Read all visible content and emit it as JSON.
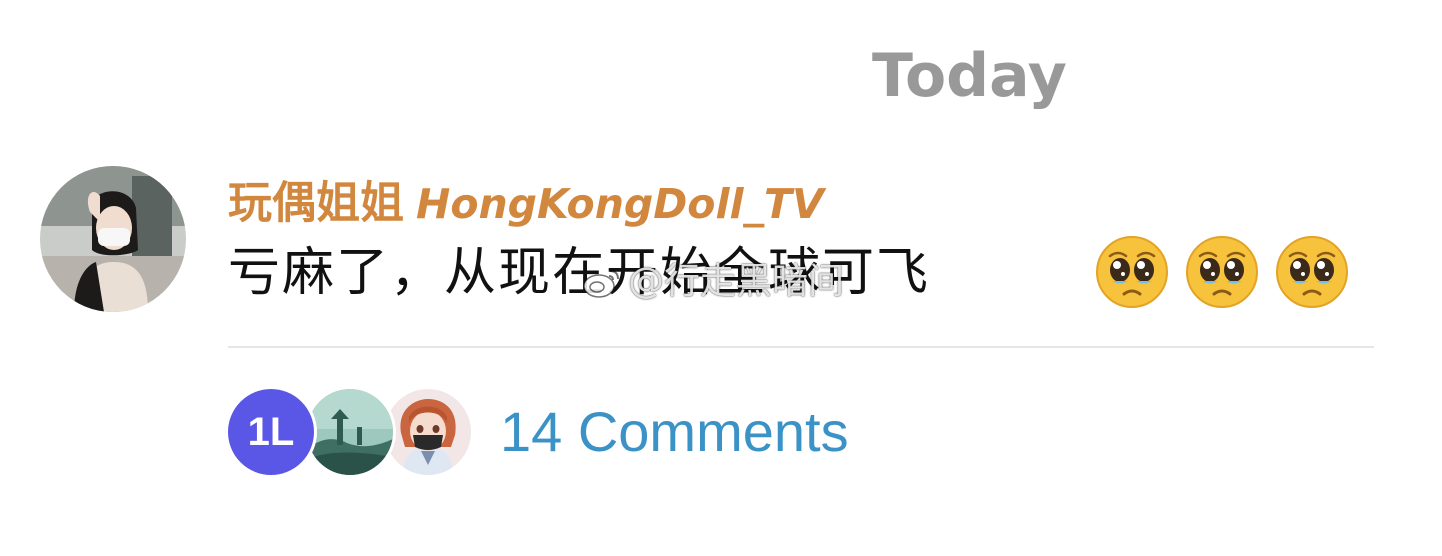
{
  "date_header": "Today",
  "message": {
    "sender_name": "玩偶姐姐",
    "sender_handle": "HongKongDoll_TV",
    "text": "亏麻了，从现在开始全球可飞",
    "emojis": [
      "pleading-face-emoji",
      "pleading-face-emoji",
      "pleading-face-emoji"
    ]
  },
  "comments": {
    "avatars": [
      {
        "initials": "1L",
        "color": "#5b57e6"
      },
      {
        "icon": "landscape-avatar"
      },
      {
        "icon": "anime-girl-avatar"
      }
    ],
    "label": "14 Comments"
  },
  "watermark": {
    "text": "@行走黑暗间",
    "icon": "weibo-logo-icon"
  },
  "colors": {
    "sender": "#d2873f",
    "comments_link": "#3a92c6",
    "date_header": "#999999",
    "initials_avatar": "#5b57e6"
  }
}
